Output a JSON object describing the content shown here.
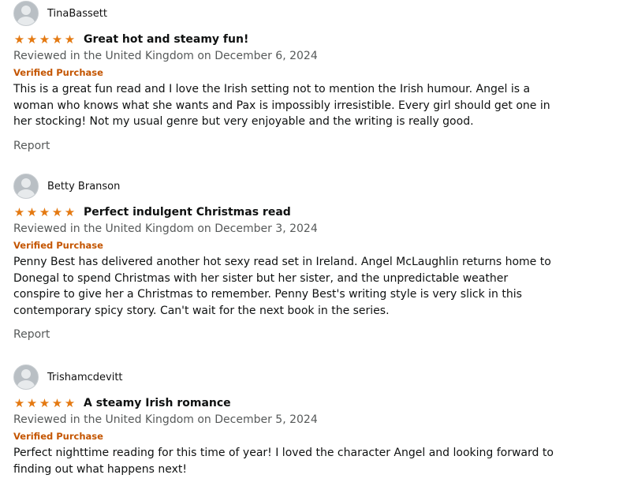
{
  "reviews": [
    {
      "reviewer": "TinaBassett",
      "rating": 5,
      "title": "Great hot and steamy fun!",
      "reviewed_in": "Reviewed in the United Kingdom on December 6, 2024",
      "verified": "Verified Purchase",
      "body": "This is a great fun read and I love the Irish setting not to mention the Irish humour. Angel is a woman who knows what she wants and Pax is impossibly irresistible. Every girl should get one in her stocking! Not my usual genre but very enjoyable and the writing is really good.",
      "report_label": "Report"
    },
    {
      "reviewer": "Betty Branson",
      "rating": 5,
      "title": "Perfect indulgent Christmas read",
      "reviewed_in": "Reviewed in the United Kingdom on December 3, 2024",
      "verified": "Verified Purchase",
      "body": "Penny Best has delivered another hot sexy read set in Ireland. Angel McLaughlin returns home to Donegal to spend Christmas with her sister but her sister, and the unpredictable weather conspire to give her a Christmas to remember. Penny Best's writing style is very slick in this contemporary spicy story. Can't wait for the next book in the series.",
      "report_label": "Report"
    },
    {
      "reviewer": "Trishamcdevitt",
      "rating": 5,
      "title": "A steamy Irish romance",
      "reviewed_in": "Reviewed in the United Kingdom on December 5, 2024",
      "verified": "Verified Purchase",
      "body": "Perfect nighttime reading for this time of year! I loved the character Angel and looking forward to finding out what happens next!"
    }
  ],
  "icons": {
    "avatar": "user-avatar-icon",
    "star": "star-icon"
  },
  "colors": {
    "star": "#e47911",
    "verified": "#c45500",
    "meta": "#565959",
    "text": "#0f1111"
  }
}
